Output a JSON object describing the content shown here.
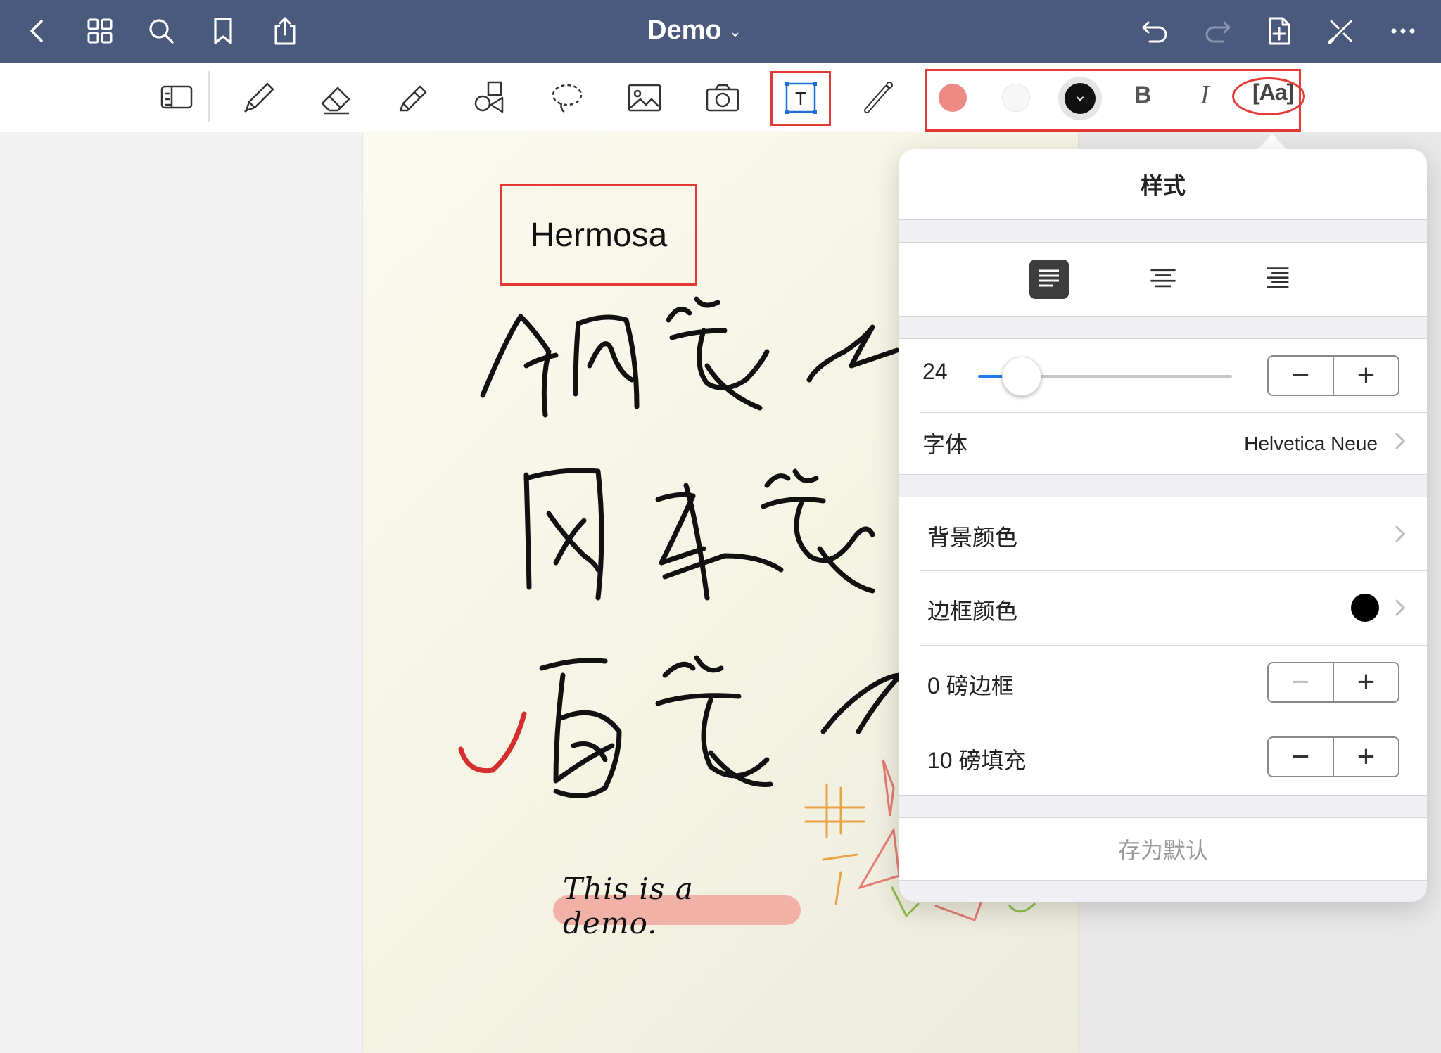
{
  "nav": {
    "title": "Demo",
    "title_chevron": "⌄"
  },
  "toolbar": {
    "bold_label": "B",
    "italic_label": "I",
    "text_tool_glyph": "T",
    "text_style_glyph": "[Aa]",
    "colors": {
      "fill": "#ee8a84",
      "background": "#ffffff",
      "text": "#111111"
    },
    "highlight_color": "#e53935"
  },
  "canvas": {
    "textbox_text": "Hermosa",
    "caption_text": "This is a demo.",
    "check_color": "#d32f2f",
    "caption_highlight": "#f1b1a7"
  },
  "style_panel": {
    "title": "样式",
    "alignment": {
      "selected": "left",
      "options": [
        "left",
        "center",
        "right"
      ]
    },
    "font_size": {
      "value": "24",
      "minus": "−",
      "plus": "+"
    },
    "font_label": "字体",
    "font_value": "Helvetica Neue",
    "background_color_label": "背景颜色",
    "border_color_label": "边框颜色",
    "border_color_value": "#000000",
    "border_width_label": "0 磅边框",
    "padding_label": "10 磅填充",
    "stepper_minus": "−",
    "stepper_plus": "+",
    "save_default_label": "存为默认"
  }
}
